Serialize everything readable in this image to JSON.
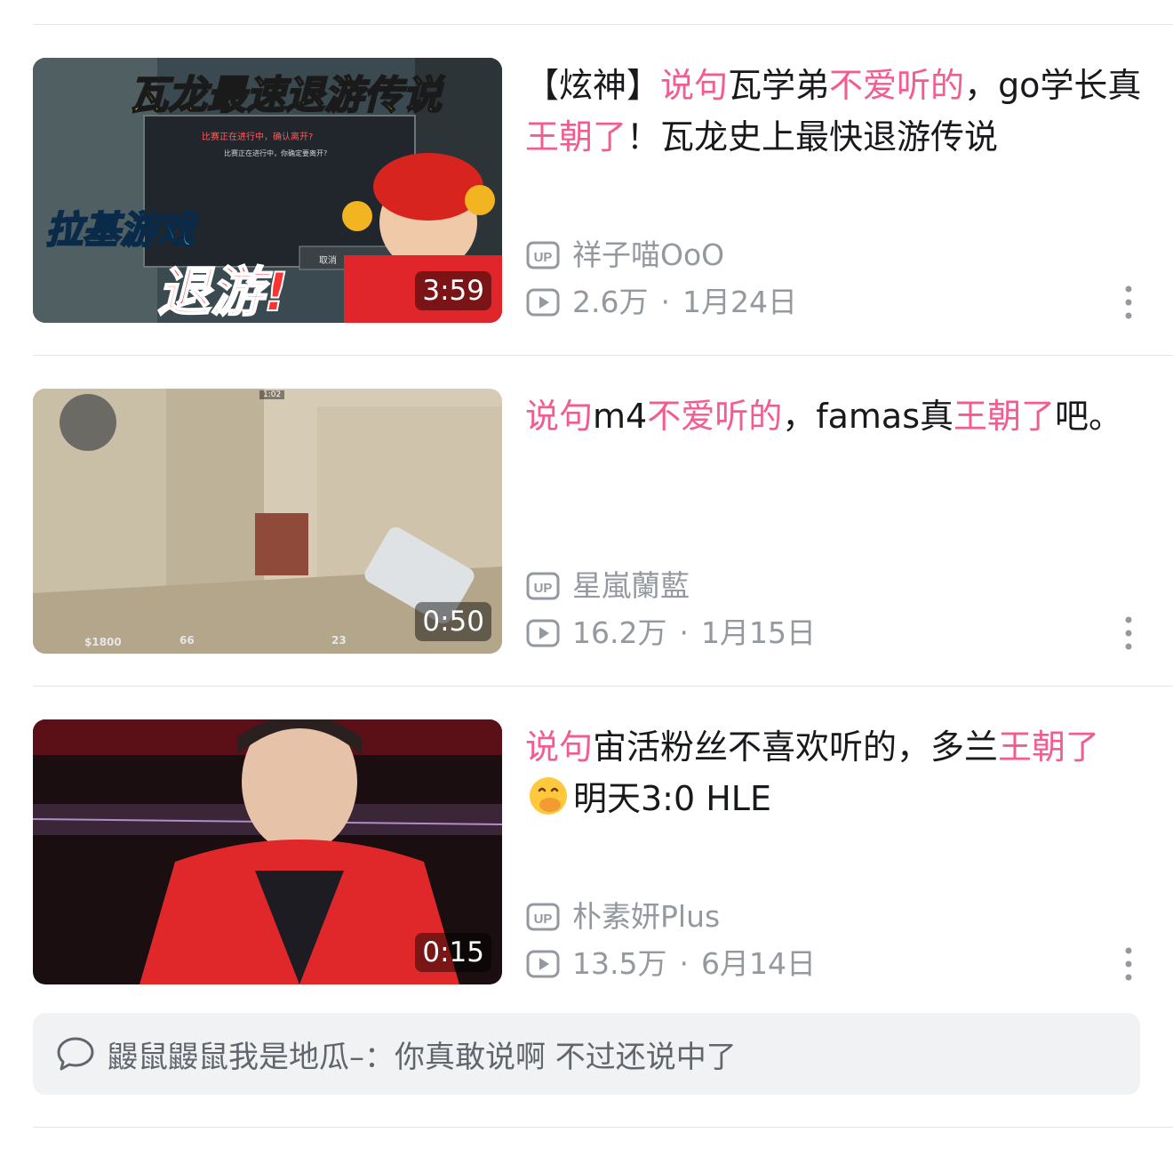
{
  "videos": [
    {
      "title_parts": [
        {
          "t": "【炫神】",
          "hl": false
        },
        {
          "t": "说句",
          "hl": true
        },
        {
          "t": "瓦学弟",
          "hl": false
        },
        {
          "t": "不爱听的",
          "hl": true
        },
        {
          "t": "，go学长真",
          "hl": false
        },
        {
          "t": "王朝了",
          "hl": true
        },
        {
          "t": "！瓦龙史上最快退游传说",
          "hl": false
        }
      ],
      "thumb_texts": [
        "瓦龙最速退游传说",
        "拉基游戏",
        "退游!",
        "比赛正在进行中，确认离开?",
        "比赛正在进行中，你确定要离开?",
        "取消"
      ],
      "duration": "3:59",
      "uploader": "祥子喵OoO",
      "views": "2.6万",
      "date": "1月24日"
    },
    {
      "title_parts": [
        {
          "t": "说句",
          "hl": true
        },
        {
          "t": "m4",
          "hl": false
        },
        {
          "t": "不爱听的",
          "hl": true
        },
        {
          "t": "，famas真",
          "hl": false
        },
        {
          "t": "王朝了",
          "hl": true
        },
        {
          "t": "吧。",
          "hl": false
        }
      ],
      "thumb_texts": [
        "$1800",
        "66",
        "23",
        "1:02"
      ],
      "duration": "0:50",
      "uploader": "星嵐蘭藍",
      "views": "16.2万",
      "date": "1月15日"
    },
    {
      "title_parts": [
        {
          "t": "说句",
          "hl": true
        },
        {
          "t": "宙活粉丝不喜欢听的，多兰",
          "hl": false
        },
        {
          "t": "王朝了",
          "hl": true
        },
        {
          "t": "[emoji]",
          "hl": false
        },
        {
          "t": "明天3:0 HLE",
          "hl": false
        }
      ],
      "duration": "0:15",
      "uploader": "朴素妍Plus",
      "views": "13.5万",
      "date": "6月14日"
    }
  ],
  "comment": {
    "user": "鼹鼠鼹鼠我是地瓜–：",
    "text": "你真敢说啊 不过还说中了"
  },
  "icons": [
    "up-badge-icon",
    "play-count-icon",
    "more-vertical-icon",
    "comment-bubble-icon",
    "face-hand-over-mouth-emoji"
  ],
  "colors": {
    "highlight": "#f25d8e",
    "meta": "#9499a0",
    "comment_bg": "#f1f2f3"
  }
}
